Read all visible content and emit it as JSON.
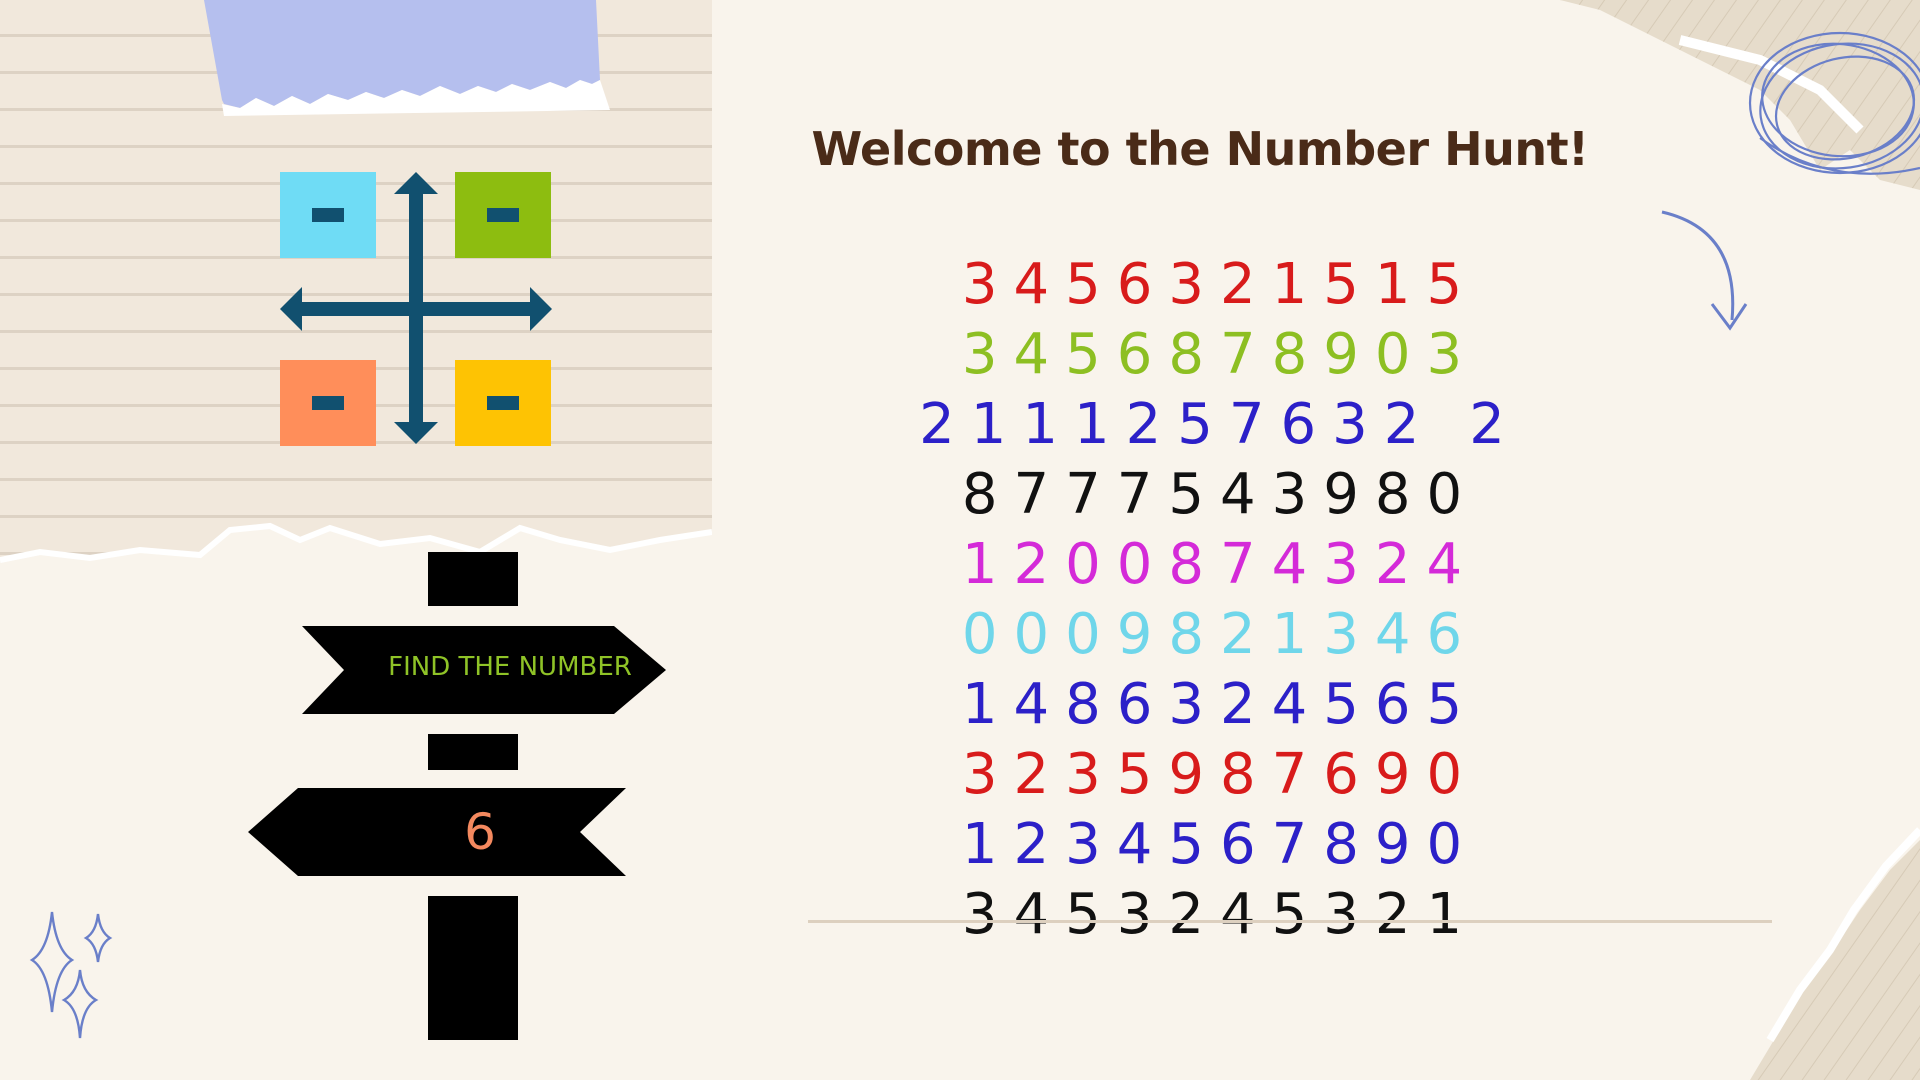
{
  "title": "Welcome to the Number Hunt!",
  "number_grid": [
    {
      "digits": "3456321515",
      "color": "#d81b1b"
    },
    {
      "digits": "3456878903",
      "color": "#8dbf22"
    },
    {
      "digits": "2111257632 2",
      "color": "#2c20c8"
    },
    {
      "digits": "8777543980",
      "color": "#111111"
    },
    {
      "digits": "1200874324",
      "color": "#d42ad8"
    },
    {
      "digits": "0009821346",
      "color": "#6fd6ea"
    },
    {
      "digits": "1486324565",
      "color": "#2c20c8"
    },
    {
      "digits": "3235987690",
      "color": "#d81b1b"
    },
    {
      "digits": "1234567890",
      "color": "#2c20c8"
    },
    {
      "digits": "3453245321",
      "color": "#111111"
    }
  ],
  "signpost": {
    "instruction": "FIND THE NUMBER",
    "target_number": "6"
  },
  "colors": {
    "background": "#f9f4ec",
    "title": "#4a2b18",
    "tape": "#b5bfee",
    "doodle": "#6a7fc9",
    "sign": "#000000",
    "instruction_text": "#8fc327",
    "target_text": "#f4895f",
    "icon_cyan": "#6fdcf5",
    "icon_green": "#8dbd10",
    "icon_orange": "#ff8e5a",
    "icon_yellow": "#fec303",
    "icon_arrow": "#11506f"
  },
  "icons": [
    "four-quadrant-arrows-icon",
    "curved-arrow-doodle-icon",
    "scribble-circle-doodle-icon",
    "sparkle-doodle-icon"
  ]
}
